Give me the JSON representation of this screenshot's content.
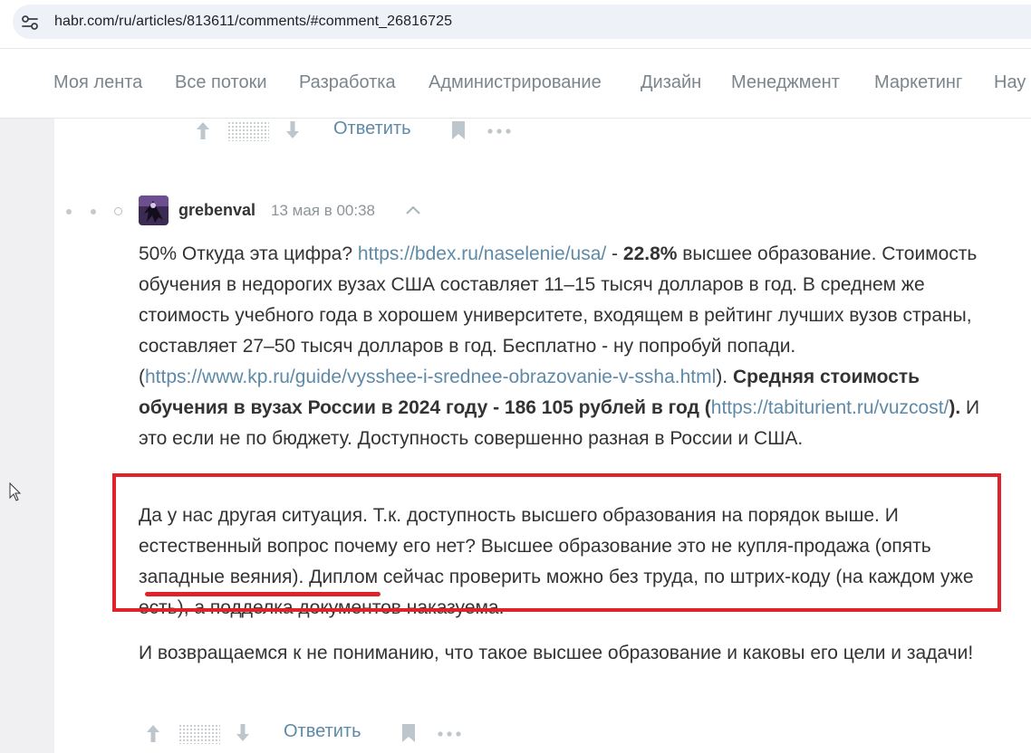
{
  "browser": {
    "url": "habr.com/ru/articles/813611/comments/#comment_26816725",
    "site_icon": "site-settings-icon"
  },
  "nav": {
    "items": [
      {
        "label": "Моя лента"
      },
      {
        "label": "Все потоки"
      },
      {
        "label": "Разработка"
      },
      {
        "label": "Администрирование"
      },
      {
        "label": "Дизайн"
      },
      {
        "label": "Менеджмент"
      },
      {
        "label": "Маркетинг"
      },
      {
        "label": "Нау"
      }
    ]
  },
  "prev_comment": {
    "reply_label": "Ответить"
  },
  "comment": {
    "author": "grebenval",
    "date": "13 мая в 00:38",
    "p1": {
      "t1": "50% Откуда эта цифра? ",
      "link1": "https://bdex.ru/naselenie/usa/",
      "t2": " - ",
      "b1": "22.8%",
      "t3": " высшее образование. Стоимость обучения в недорогих вузах США составляет 11–15 тысяч долларов в год. В среднем же стоимость учебного года в хорошем университете, входящем в рейтинг лучших вузов страны, составляет 27–50 тысяч долларов в год. Бесплатно - ну попробуй попади. (",
      "link2": "https://www.kp.ru/guide/vysshee-i-srednee-obrazovanie-v-ssha.html",
      "t4": "). ",
      "b2": "Средняя стоимость обучения в вузах России в 2024 году - 186 105 рублей в год (",
      "link3": "https://tabiturient.ru/vuzcost/",
      "b3": ").",
      "t5": " И это если не по бюджету. Доступность совершенно разная в России и США."
    },
    "p2": "Да у нас другая ситуация. Т.к. доступность высшего образования на порядок выше. И естественный вопрос почему его нет? Высшее образование это не купля-продажа (опять западные веяния). Диплом сейчас проверить можно без труда, по штрих-коду (на каждом уже есть), а подделка документов наказуема.",
    "p3": "И возвращаемся к не пониманию, что такое высшее образование и каковы его цели и задачи!",
    "reply_label": "Ответить"
  },
  "colors": {
    "accent_link": "#5e8aa8",
    "annotation_red": "#e0232b",
    "nav_text": "#7b858c"
  }
}
